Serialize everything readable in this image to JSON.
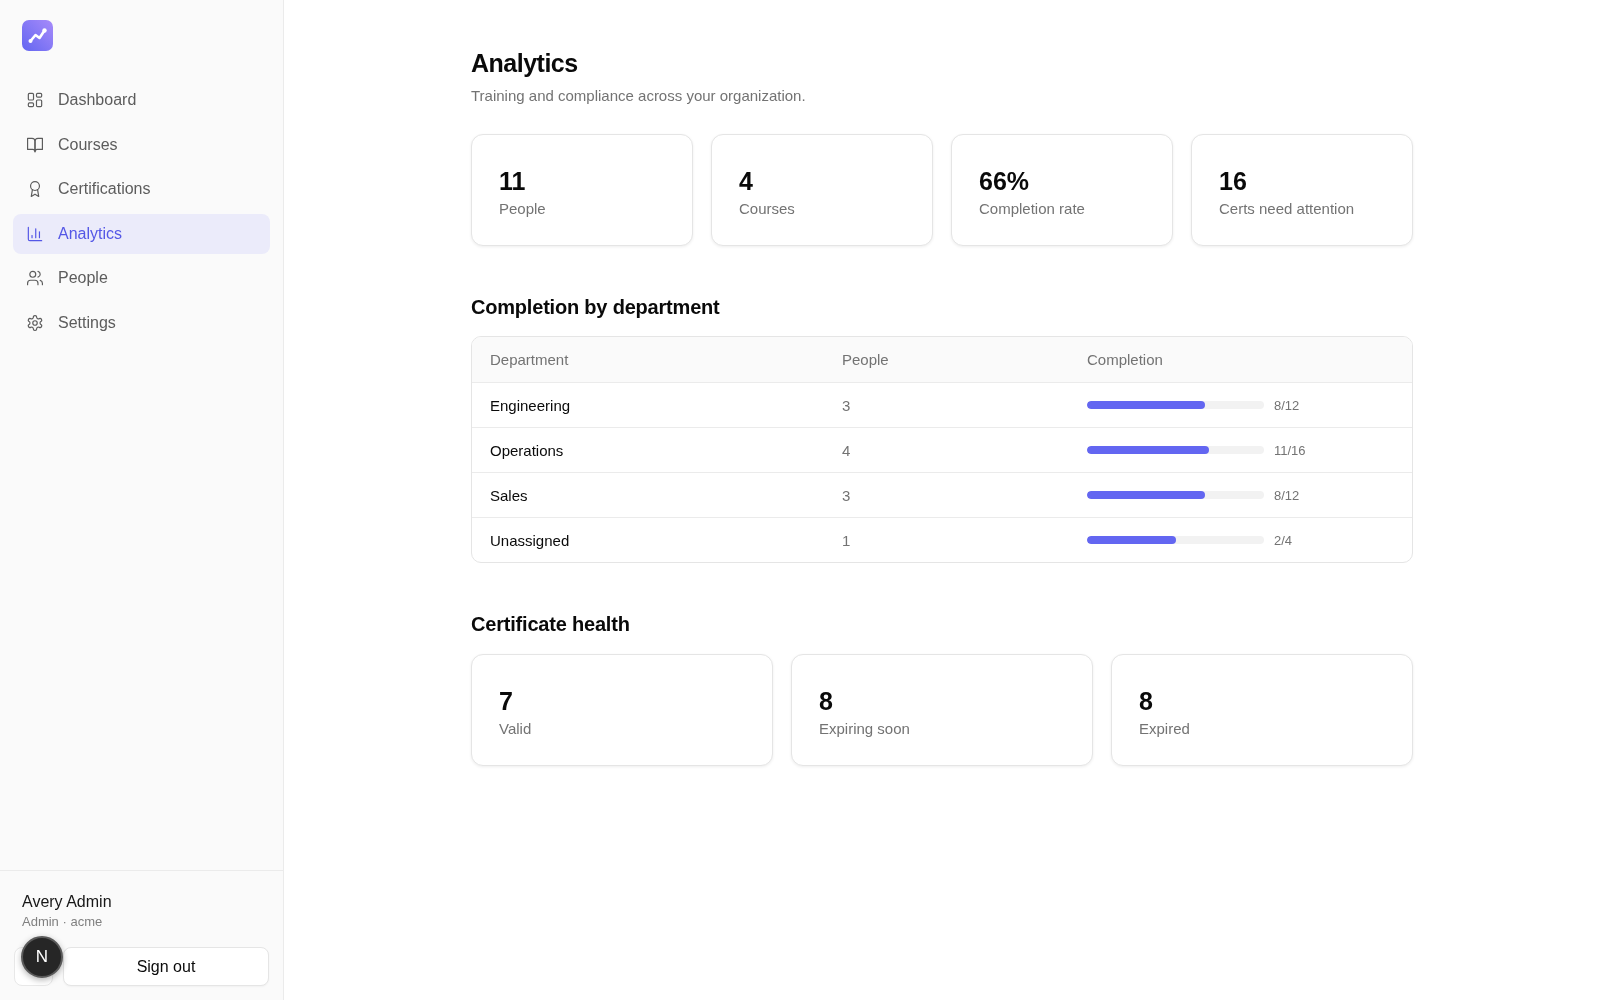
{
  "sidebar": {
    "nav_items": [
      {
        "label": "Dashboard",
        "selected": false
      },
      {
        "label": "Courses",
        "selected": false
      },
      {
        "label": "Certifications",
        "selected": false
      },
      {
        "label": "Analytics",
        "selected": true
      },
      {
        "label": "People",
        "selected": false
      },
      {
        "label": "Settings",
        "selected": false
      }
    ],
    "user": {
      "name": "Avery Admin",
      "meta": "Admin · acme"
    },
    "sign_out_button": "Sign out"
  },
  "dev_badge": {
    "label": "N"
  },
  "page": {
    "title": "Analytics",
    "subtitle": "Training and compliance across your organization."
  },
  "stats": [
    {
      "value": "11",
      "label": "People"
    },
    {
      "value": "4",
      "label": "Courses"
    },
    {
      "value": "66%",
      "label": "Completion rate"
    },
    {
      "value": "16",
      "label": "Certs need attention"
    }
  ],
  "department_section": {
    "title": "Completion by department",
    "table": {
      "columns": [
        "Department",
        "People",
        "Completion"
      ],
      "rows": [
        {
          "department": "Engineering",
          "people": "3",
          "level": 0.667,
          "reading": "8/12"
        },
        {
          "department": "Operations",
          "people": "4",
          "level": 0.6875,
          "reading": "11/16"
        },
        {
          "department": "Sales",
          "people": "3",
          "level": 0.667,
          "reading": "8/12"
        },
        {
          "department": "Unassigned",
          "people": "1",
          "level": 0.5,
          "reading": "2/4"
        }
      ]
    }
  },
  "certificate_section": {
    "title": "Certificate health",
    "cards": [
      {
        "value": "7",
        "label": "Valid"
      },
      {
        "value": "8",
        "label": "Expiring soon"
      },
      {
        "value": "8",
        "label": "Expired"
      }
    ]
  }
}
